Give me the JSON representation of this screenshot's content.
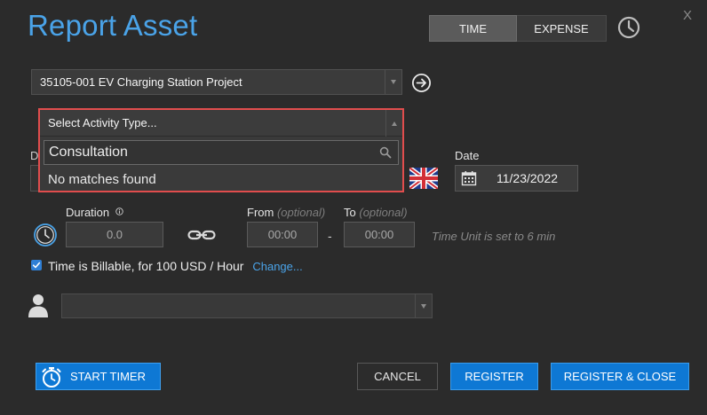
{
  "dialog": {
    "title": "Report Asset",
    "close_glyph": "X"
  },
  "mode_tabs": [
    {
      "label": "TIME",
      "selected": true
    },
    {
      "label": "EXPENSE",
      "selected": false
    }
  ],
  "icons": {
    "history": "clock-history-icon",
    "goto": "arrow-circle-right-icon",
    "flag": "uk-flag-icon",
    "calendar": "calendar-icon",
    "clock": "clock-icon",
    "info": "info-circle-icon",
    "link": "chain-link-icon",
    "person": "person-icon",
    "timer": "stopwatch-icon",
    "search": "search-icon",
    "check": "checkmark-icon"
  },
  "project_select": {
    "value": "35105-001 EV Charging Station Project"
  },
  "activity_dropdown": {
    "placeholder": "Select Activity Type...",
    "search_value": "Consultation",
    "empty_message": "No matches found"
  },
  "hidden_field_label_fragment": "D",
  "date": {
    "label": "Date",
    "value": "11/23/2022"
  },
  "duration": {
    "label": "Duration",
    "value": "0.0"
  },
  "from": {
    "label": "From",
    "optional": "(optional)",
    "value": "00:00"
  },
  "to": {
    "label": "To",
    "optional": "(optional)",
    "value": "00:00"
  },
  "separator": "-",
  "time_unit_note": "Time Unit is set to 6 min",
  "billable": {
    "checked": true,
    "text": "Time is Billable, for 100 USD / Hour",
    "change_label": "Change..."
  },
  "person_select": {
    "value": ""
  },
  "buttons": {
    "start_timer": "START TIMER",
    "cancel": "CANCEL",
    "register": "REGISTER",
    "register_close": "REGISTER & CLOSE"
  },
  "colors": {
    "accent": "#4aa3e8",
    "primary_button": "#0e78d4",
    "highlight_outline": "#e14d4d",
    "background": "#2b2b2b"
  }
}
